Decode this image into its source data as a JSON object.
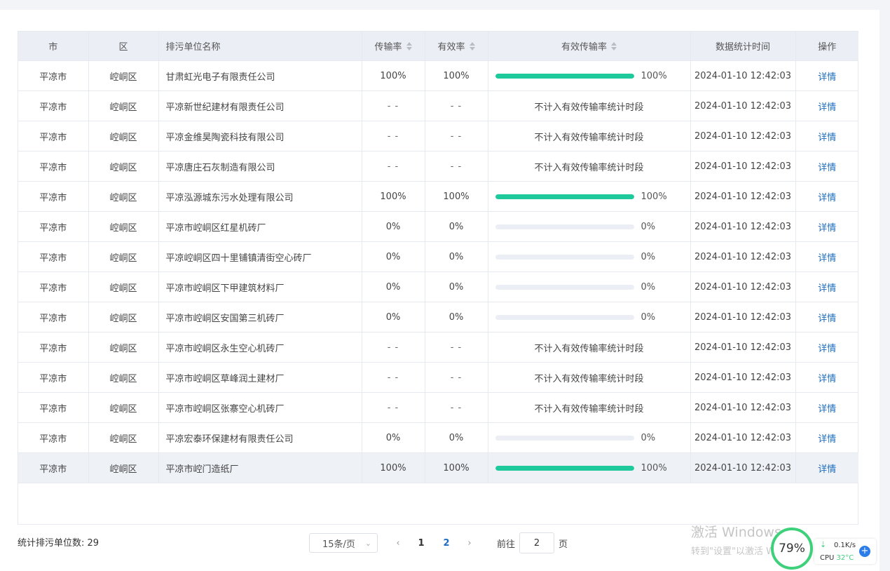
{
  "table": {
    "headers": {
      "city": "市",
      "district": "区",
      "unit_name": "排污单位名称",
      "transmission_rate": "传输率",
      "valid_rate": "有效率",
      "valid_transmission_rate": "有效传输率",
      "stat_time": "数据统计时间",
      "action": "操作"
    },
    "not_counted_text": "不计入有效传输率统计时段",
    "rows": [
      {
        "city": "平凉市",
        "district": "崆峒区",
        "name": "甘肃虹光电子有限责任公司",
        "trans": "100%",
        "valid": "100%",
        "vtr_type": "bar",
        "vtr_value": 100,
        "vtr_label": "100%",
        "time": "2024-01-10 12:42:03",
        "action": "详情"
      },
      {
        "city": "平凉市",
        "district": "崆峒区",
        "name": "平凉新世纪建材有限责任公司",
        "trans": "- -",
        "valid": "- -",
        "vtr_type": "text",
        "time": "2024-01-10 12:42:03",
        "action": "详情"
      },
      {
        "city": "平凉市",
        "district": "崆峒区",
        "name": "平凉金维昊陶瓷科技有限公司",
        "trans": "- -",
        "valid": "- -",
        "vtr_type": "text",
        "time": "2024-01-10 12:42:03",
        "action": "详情"
      },
      {
        "city": "平凉市",
        "district": "崆峒区",
        "name": "平凉唐庄石灰制造有限公司",
        "trans": "- -",
        "valid": "- -",
        "vtr_type": "text",
        "time": "2024-01-10 12:42:03",
        "action": "详情"
      },
      {
        "city": "平凉市",
        "district": "崆峒区",
        "name": "平凉泓源城东污水处理有限公司",
        "trans": "100%",
        "valid": "100%",
        "vtr_type": "bar",
        "vtr_value": 100,
        "vtr_label": "100%",
        "time": "2024-01-10 12:42:03",
        "action": "详情"
      },
      {
        "city": "平凉市",
        "district": "崆峒区",
        "name": "平凉市崆峒区红星机砖厂",
        "trans": "0%",
        "valid": "0%",
        "vtr_type": "bar",
        "vtr_value": 0,
        "vtr_label": "0%",
        "time": "2024-01-10 12:42:03",
        "action": "详情"
      },
      {
        "city": "平凉市",
        "district": "崆峒区",
        "name": "平凉崆峒区四十里铺镇清街空心砖厂",
        "trans": "0%",
        "valid": "0%",
        "vtr_type": "bar",
        "vtr_value": 0,
        "vtr_label": "0%",
        "time": "2024-01-10 12:42:03",
        "action": "详情"
      },
      {
        "city": "平凉市",
        "district": "崆峒区",
        "name": "平凉市崆峒区下甲建筑材料厂",
        "trans": "0%",
        "valid": "0%",
        "vtr_type": "bar",
        "vtr_value": 0,
        "vtr_label": "0%",
        "time": "2024-01-10 12:42:03",
        "action": "详情"
      },
      {
        "city": "平凉市",
        "district": "崆峒区",
        "name": "平凉市崆峒区安国第三机砖厂",
        "trans": "0%",
        "valid": "0%",
        "vtr_type": "bar",
        "vtr_value": 0,
        "vtr_label": "0%",
        "time": "2024-01-10 12:42:03",
        "action": "详情"
      },
      {
        "city": "平凉市",
        "district": "崆峒区",
        "name": "平凉市崆峒区永生空心机砖厂",
        "trans": "- -",
        "valid": "- -",
        "vtr_type": "text",
        "time": "2024-01-10 12:42:03",
        "action": "详情"
      },
      {
        "city": "平凉市",
        "district": "崆峒区",
        "name": "平凉市崆峒区草峰润土建材厂",
        "trans": "- -",
        "valid": "- -",
        "vtr_type": "text",
        "time": "2024-01-10 12:42:03",
        "action": "详情"
      },
      {
        "city": "平凉市",
        "district": "崆峒区",
        "name": "平凉市崆峒区张寨空心机砖厂",
        "trans": "- -",
        "valid": "- -",
        "vtr_type": "text",
        "time": "2024-01-10 12:42:03",
        "action": "详情"
      },
      {
        "city": "平凉市",
        "district": "崆峒区",
        "name": "平凉宏泰环保建材有限责任公司",
        "trans": "0%",
        "valid": "0%",
        "vtr_type": "bar",
        "vtr_value": 0,
        "vtr_label": "0%",
        "time": "2024-01-10 12:42:03",
        "action": "详情"
      },
      {
        "city": "平凉市",
        "district": "崆峒区",
        "name": "平凉市崆门造纸厂",
        "trans": "100%",
        "valid": "100%",
        "vtr_type": "bar",
        "vtr_value": 100,
        "vtr_label": "100%",
        "time": "2024-01-10 12:42:03",
        "action": "详情",
        "highlighted": true
      }
    ]
  },
  "footer": {
    "count_label": "统计排污单位数:",
    "count_value": "29"
  },
  "pagination": {
    "page_size": "15条/页",
    "pages": [
      "1",
      "2"
    ],
    "current_page": "1",
    "goto_prefix": "前往",
    "goto_value": "2",
    "goto_suffix": "页"
  },
  "overlay": {
    "watermark_line1": "激活 Windows",
    "watermark_line2": "转到\"设置\"以激活 Windo",
    "cpu_percent": "79%",
    "net_speed": "0.1K/s",
    "cpu_label": "CPU",
    "cpu_temp": "32°C"
  },
  "colors": {
    "progress_fill": "#1ec99b",
    "progress_track": "#ebeef5",
    "link": "#1c6dbe",
    "header_bg": "#ebeef5"
  }
}
